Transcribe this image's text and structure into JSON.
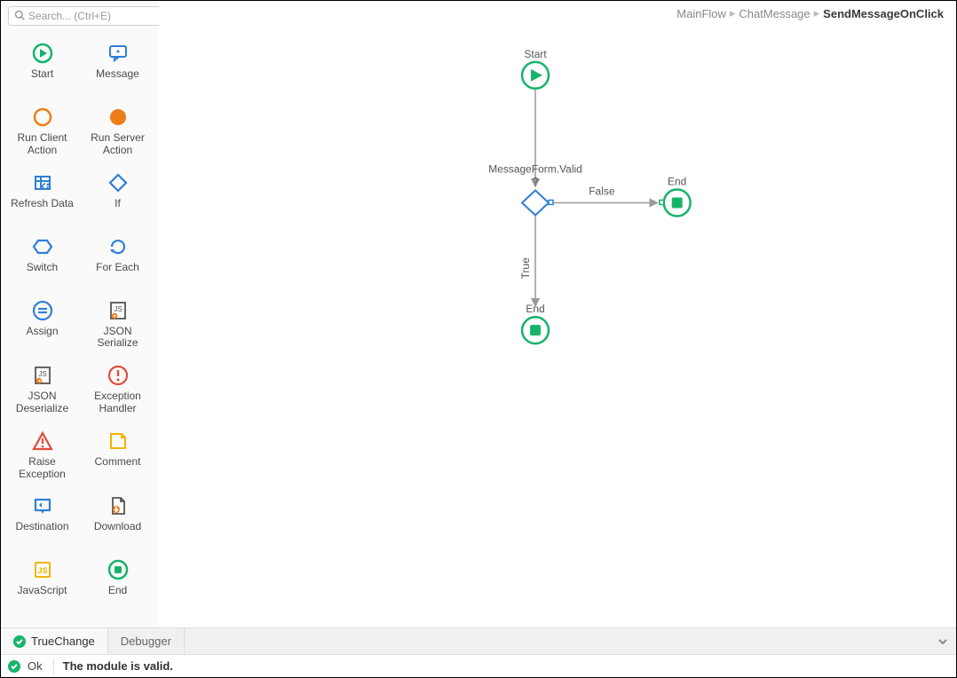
{
  "search": {
    "placeholder": "Search... (Ctrl+E)"
  },
  "toolbox": {
    "items": [
      {
        "label": "Start",
        "icon": "start"
      },
      {
        "label": "Message",
        "icon": "message"
      },
      {
        "label": "Run Client Action",
        "icon": "client-action"
      },
      {
        "label": "Run Server Action",
        "icon": "server-action"
      },
      {
        "label": "Refresh Data",
        "icon": "refresh-data"
      },
      {
        "label": "If",
        "icon": "if"
      },
      {
        "label": "Switch",
        "icon": "switch"
      },
      {
        "label": "For Each",
        "icon": "foreach"
      },
      {
        "label": "Assign",
        "icon": "assign"
      },
      {
        "label": "JSON Serialize",
        "icon": "json-serialize"
      },
      {
        "label": "JSON Deserialize",
        "icon": "json-deserialize"
      },
      {
        "label": "Exception Handler",
        "icon": "exception-handler"
      },
      {
        "label": "Raise Exception",
        "icon": "raise-exception"
      },
      {
        "label": "Comment",
        "icon": "comment"
      },
      {
        "label": "Destination",
        "icon": "destination"
      },
      {
        "label": "Download",
        "icon": "download"
      },
      {
        "label": "JavaScript",
        "icon": "javascript"
      },
      {
        "label": "End",
        "icon": "end"
      }
    ]
  },
  "breadcrumb": {
    "items": [
      "MainFlow",
      "ChatMessage",
      "SendMessageOnClick"
    ]
  },
  "flow": {
    "start_label": "Start",
    "if_label": "MessageForm.Valid?",
    "true_label": "True",
    "false_label": "False",
    "end_true_label": "End",
    "end_false_label": "End"
  },
  "tabs": {
    "truechange": "TrueChange",
    "debugger": "Debugger"
  },
  "status": {
    "ok": "Ok",
    "message": "The module is valid."
  },
  "colors": {
    "green": "#17b36a",
    "blue": "#2f7ed8",
    "orange": "#ef7c1a",
    "red": "#e24b3b",
    "yellow": "#f4b400",
    "gray": "#888888"
  }
}
